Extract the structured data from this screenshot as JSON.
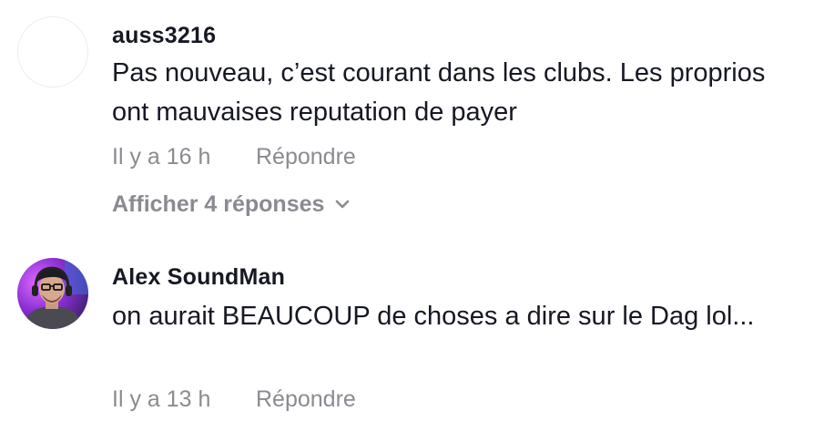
{
  "comments": [
    {
      "username": "auss3216",
      "text": "Pas nouveau, c’est courant dans les clubs. Les proprios ont mauvaises reputation de payer",
      "time": "Il y a 16 h",
      "reply_label": "Répondre",
      "view_replies_label": "Afficher 4 réponses"
    },
    {
      "username": "Alex SoundMan",
      "text": "on aurait BEAUCOUP de choses a dire sur le Dag lol...",
      "time": "Il y a 13 h",
      "reply_label": "Répondre"
    }
  ]
}
